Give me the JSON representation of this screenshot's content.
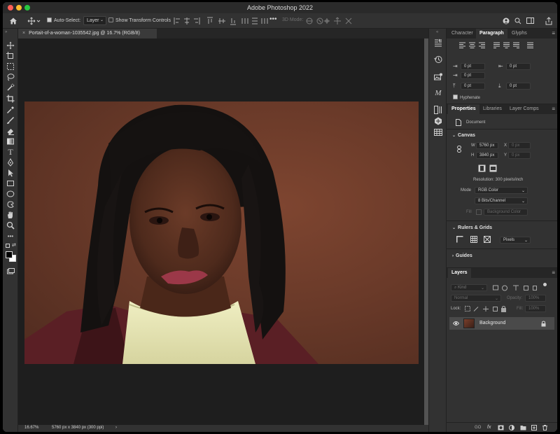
{
  "window": {
    "title": "Adobe Photoshop 2022"
  },
  "colors": {
    "close": "#ff5f57",
    "minimize": "#febc2e",
    "zoom": "#28c840",
    "canvas_bg": "#1e1e1e",
    "panel_bg": "#323232"
  },
  "options_bar": {
    "auto_select_label": "Auto-Select:",
    "auto_select_checked": true,
    "auto_select_target": "Layer",
    "show_transform_label": "Show Transform Controls",
    "show_transform_checked": false,
    "more": "•••",
    "mode_3d": "3D Mode:"
  },
  "document_tab": {
    "close": "×",
    "label": "Portait-of-a-woman-1035542.jpg @ 16.7% (RGB/8)"
  },
  "toolbar": {
    "tools": [
      "move-tool",
      "artboard-tool",
      "marquee-tool",
      "lasso-tool",
      "quick-select-tool",
      "crop-tool",
      "eyedropper-tool",
      "brush-tool",
      "eraser-tool",
      "gradient-tool",
      "type-tool",
      "pen-tool",
      "path-select-tool",
      "rectangle-tool",
      "ellipse-tool",
      "custom-shape-tool",
      "hand-tool",
      "zoom-tool",
      "more-tools",
      "color-swatches",
      "screen-mode"
    ],
    "type_glyph": "T",
    "more_glyph": "•••"
  },
  "status_bar": {
    "zoom": "16.67%",
    "info": "5760 px x 3840 px (300 ppi)",
    "arrow": "›"
  },
  "panels": {
    "char_tabs": {
      "character": "Character",
      "paragraph": "Paragraph",
      "glyphs": "Glyphs"
    },
    "paragraph": {
      "indent_left": "0 pt",
      "indent_right": "0 pt",
      "first_line": "0 pt",
      "space_before": "0 pt",
      "space_after": "0 pt",
      "hyphenate_label": "Hyphenate",
      "hyphenate_checked": true
    },
    "props_tabs": {
      "properties": "Properties",
      "libraries": "Libraries",
      "layer_comps": "Layer Comps"
    },
    "properties": {
      "document_label": "Document",
      "canvas_label": "Canvas",
      "w_label": "W",
      "w_value": "5760 px",
      "h_label": "H",
      "h_value": "3840 px",
      "x_label": "X",
      "x_value": "0 px",
      "y_label": "Y",
      "y_value": "0 px",
      "resolution": "Resolution: 300 pixels/inch",
      "mode_label": "Mode",
      "mode_value": "RGB Color",
      "bits_value": "8 Bits/Channel",
      "fill_label": "Fill",
      "fill_value": "Background Color",
      "rulers_label": "Rulers & Grids",
      "units_value": "Pixels",
      "guides_label": "Guides"
    },
    "layers": {
      "tab": "Layers",
      "kind_placeholder": "Kind",
      "blend_mode": "Normal",
      "opacity_label": "Opacity:",
      "opacity_value": "100%",
      "lock_label": "Lock:",
      "fill_label": "Fill:",
      "fill_value": "100%",
      "items": [
        {
          "name": "Background",
          "visible": true,
          "locked": true
        }
      ],
      "bottom": {
        "link": "GO",
        "fx": "fx"
      }
    }
  }
}
